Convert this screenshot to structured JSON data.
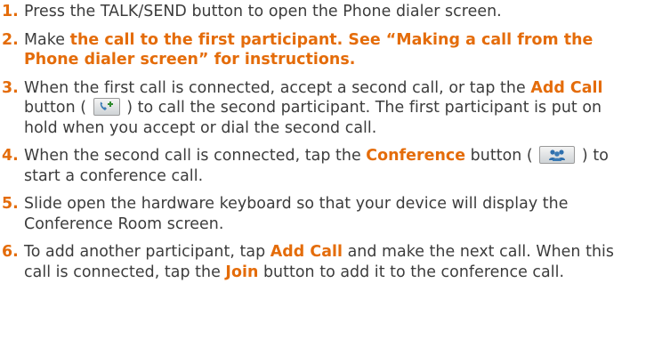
{
  "steps": [
    {
      "num": "1.",
      "parts": {
        "a": "Press the TALK/SEND button to open the Phone dialer screen."
      }
    },
    {
      "num": "2.",
      "parts": {
        "a": "Make ",
        "b": "the call to the first participant. See “Making a call from the Phone dialer screen” for instructions."
      }
    },
    {
      "num": "3.",
      "parts": {
        "a": "When the first call is connected, accept a second call, or tap the ",
        "b": "Add Call",
        "c": " button ( ",
        "d": " ) to call the second participant. The first participant is put on hold when you accept or dial the second call."
      }
    },
    {
      "num": "4.",
      "parts": {
        "a": "When the second call is connected, tap the ",
        "b": "Conference",
        "c": " button ( ",
        "d": " ) to start a conference call."
      }
    },
    {
      "num": "5.",
      "parts": {
        "a": "Slide open the hardware keyboard so that your device will display the Conference Room screen."
      }
    },
    {
      "num": "6.",
      "parts": {
        "a": "To add another participant, tap ",
        "b": "Add Call",
        "c": " and make the next call. When this call is connected, tap the ",
        "d": "Join",
        "e": " button to add it to the conference call."
      }
    }
  ],
  "icons": {
    "add_call": "add-call-icon",
    "conference": "conference-icon"
  },
  "colors": {
    "accent": "#e46c0a",
    "text": "#3c3c3c"
  }
}
